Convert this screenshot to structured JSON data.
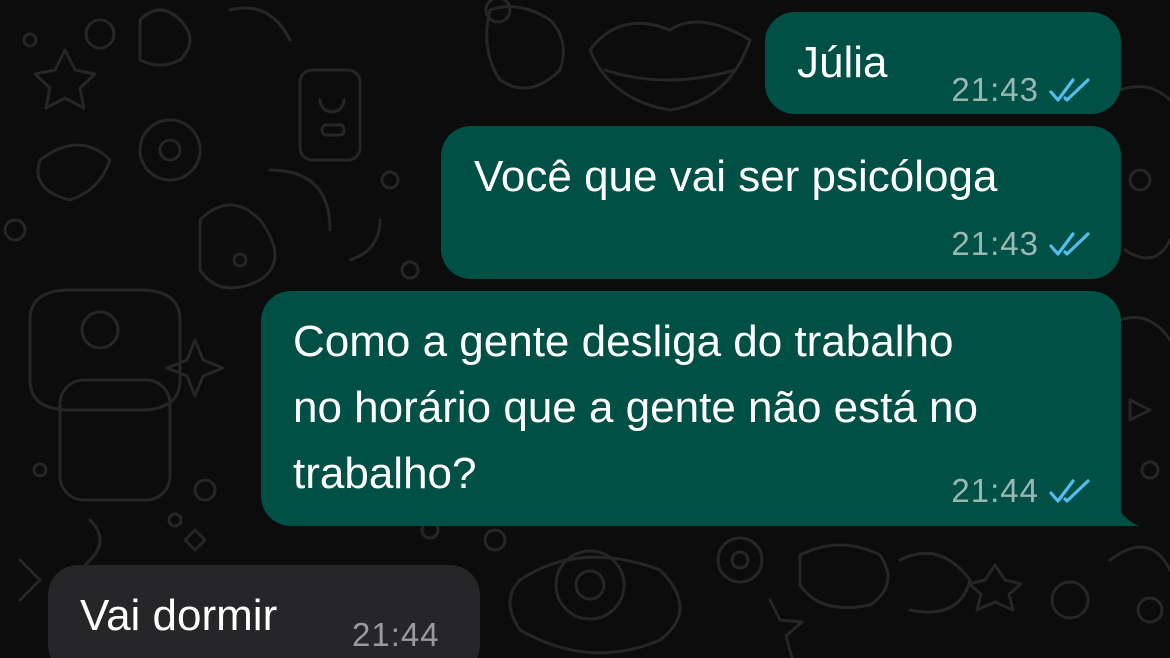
{
  "colors": {
    "background": "#0c0c0c",
    "outgoing_bubble": "#005045",
    "incoming_bubble": "#262628",
    "read_ticks": "#53bdeb",
    "timestamp_out": "#9bb7b2",
    "timestamp_in": "#9a9a9e"
  },
  "messages": [
    {
      "direction": "outgoing",
      "text": "Júlia",
      "time": "21:43",
      "status_icon": "double-check-read-icon"
    },
    {
      "direction": "outgoing",
      "text": "Você que vai ser psicóloga",
      "time": "21:43",
      "status_icon": "double-check-read-icon"
    },
    {
      "direction": "outgoing",
      "text": "Como a gente desliga do trabalho\nno horário que a gente não está no\ntrabalho?",
      "time": "21:44",
      "status_icon": "double-check-read-icon"
    },
    {
      "direction": "incoming",
      "text": "Vai dormir",
      "time": "21:44"
    }
  ]
}
